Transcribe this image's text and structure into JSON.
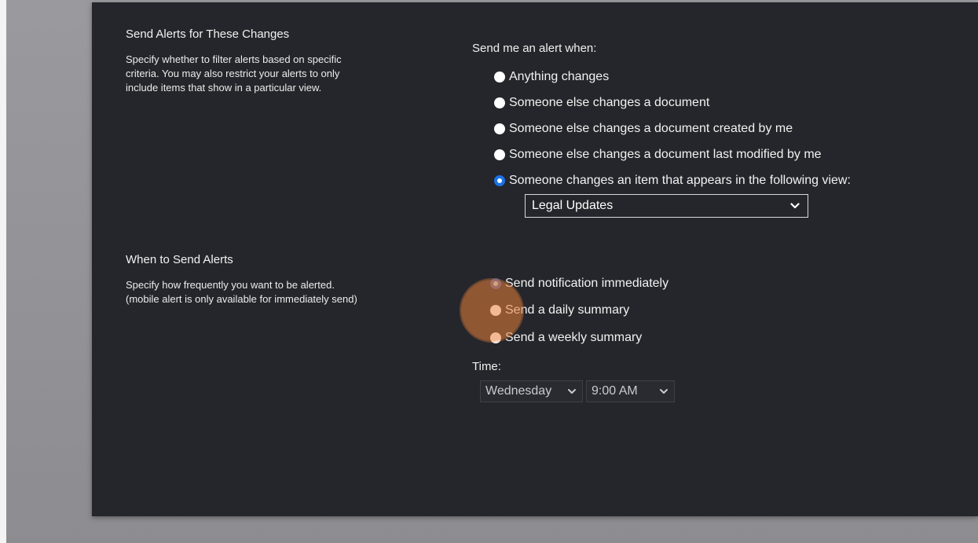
{
  "alerts_section": {
    "title": "Send Alerts for These Changes",
    "description_lines": [
      "Specify whether to filter alerts based on specific",
      "criteria. You may also restrict your alerts to only",
      "include items that show in a particular view."
    ],
    "prompt": "Send me an alert when:",
    "options": [
      {
        "label": "Anything changes",
        "checked": false
      },
      {
        "label": "Someone else changes a document",
        "checked": false
      },
      {
        "label": "Someone else changes a document created by me",
        "checked": false
      },
      {
        "label": "Someone else changes a document last modified by me",
        "checked": false
      },
      {
        "label": "Someone changes an item that appears in the following view:",
        "checked": true
      }
    ],
    "view_select": {
      "value": "Legal Updates"
    }
  },
  "when_section": {
    "title": "When to Send Alerts",
    "description_lines": [
      "Specify how frequently you want to be alerted.",
      "(mobile alert is only available for immediately send)"
    ],
    "options": [
      {
        "label": "Send notification immediately",
        "checked": true
      },
      {
        "label": "Send a daily summary",
        "checked": false
      },
      {
        "label": "Send a weekly summary",
        "checked": false
      }
    ],
    "time_label": "Time:",
    "day_select": {
      "value": "Wednesday"
    },
    "time_select": {
      "value": "9:00 AM"
    }
  },
  "colors": {
    "panel": "#25262b",
    "radio_checked": "#1a73e8",
    "cursor_highlight": "#e88038"
  },
  "icons": {
    "dropdown": "chevron-down-icon",
    "cursor": "click-highlight-icon"
  }
}
